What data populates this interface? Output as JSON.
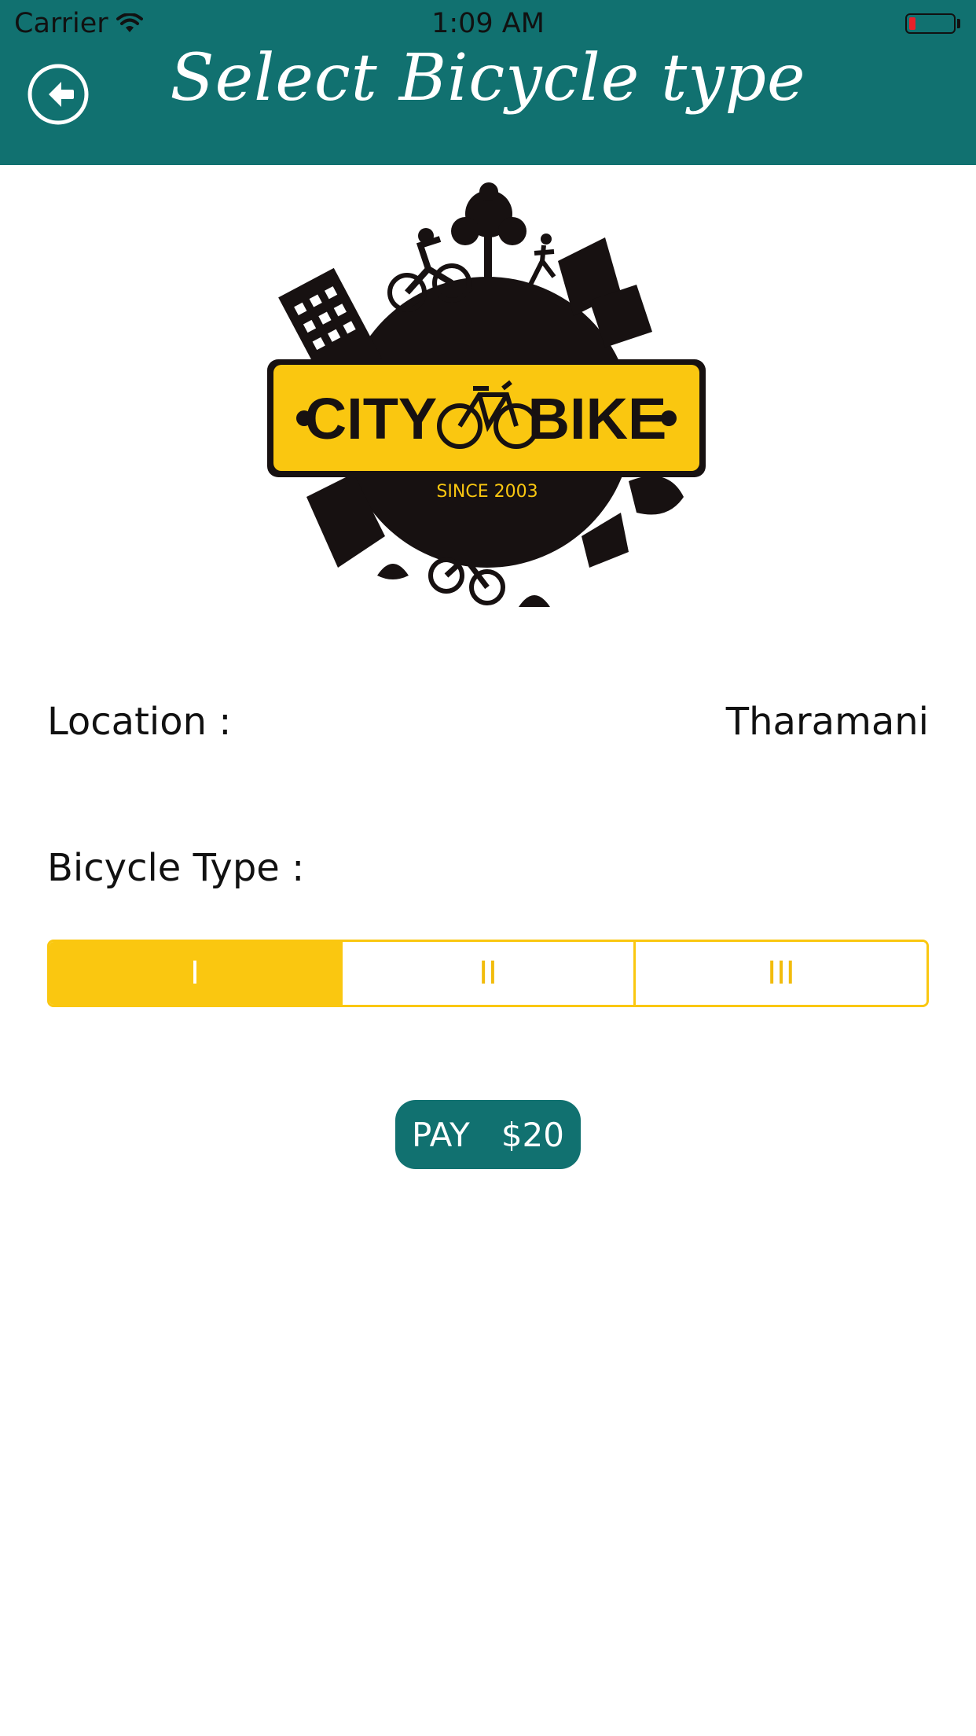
{
  "status_bar": {
    "carrier": "Carrier",
    "time": "1:09 AM",
    "battery_color": "#e8202a"
  },
  "navbar": {
    "title": "Select Bicycle type",
    "back_icon": "arrow-left-circle-icon",
    "background_color": "#117170"
  },
  "logo": {
    "line1_left": "CITY",
    "line1_right": "BIKE",
    "since": "SINCE 2003",
    "badge_color": "#fac710"
  },
  "form": {
    "location_label": "Location  :",
    "location_value": "Tharamani",
    "bicycle_type_label": "Bicycle Type  :"
  },
  "bicycle_types": {
    "options": [
      "I",
      "II",
      "III"
    ],
    "selected": "I",
    "accent_color": "#fac710"
  },
  "pay_button": {
    "label": "PAY   $20"
  }
}
